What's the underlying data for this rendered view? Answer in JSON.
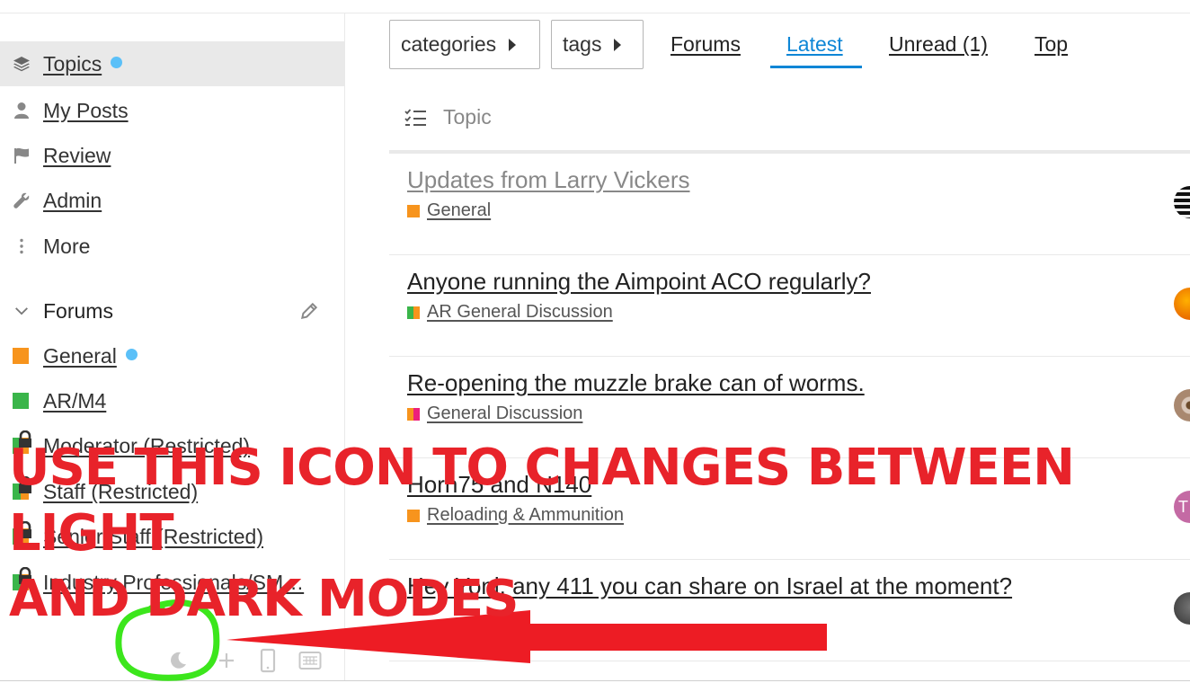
{
  "nav": {
    "categories_label": "categories",
    "tags_label": "tags",
    "forums_label": "Forums",
    "latest_label": "Latest",
    "unread_label": "Unread (1)",
    "top_label": "Top"
  },
  "sidebar": {
    "items": [
      {
        "label": "Topics",
        "icon": "layers-icon"
      },
      {
        "label": "My Posts",
        "icon": "user-icon"
      },
      {
        "label": "Review",
        "icon": "flag-icon"
      },
      {
        "label": "Admin",
        "icon": "wrench-icon"
      },
      {
        "label": "More",
        "icon": "ellipsis-vertical-icon"
      }
    ],
    "forums_header": "Forums",
    "categories": [
      {
        "label": "General",
        "colors": [
          "#f7941d"
        ]
      },
      {
        "label": "AR/M4",
        "colors": [
          "#3ab54a"
        ]
      },
      {
        "label": "Moderator (Restricted)",
        "colors": [
          "#3ab54a",
          "#f7941d"
        ]
      },
      {
        "label": "Staff (Restricted)",
        "colors": [
          "#3ab54a",
          "#f7941d"
        ]
      },
      {
        "label": "Senior Staff (Restricted)",
        "colors": [
          "#3ab54a",
          "#f7941d"
        ]
      },
      {
        "label": "Industry Professionals/SM…",
        "colors": [
          "#3ab54a",
          "#f7941d"
        ]
      }
    ],
    "footer_icons": [
      "moon-icon",
      "plus-icon",
      "mobile-icon",
      "keyboard-icon"
    ]
  },
  "list": {
    "column_header": "Topic",
    "topics": [
      {
        "title": "Updates from Larry Vickers",
        "category": "General",
        "colors": [
          "#f7941d"
        ]
      },
      {
        "title": "Anyone running the Aimpoint ACO regularly?",
        "category": "AR General Discussion",
        "colors": [
          "#3ab54a",
          "#f7941d"
        ]
      },
      {
        "title": "Re-opening the muzzle brake can of worms.",
        "category": "General Discussion",
        "colors": [
          "#f7941d",
          "#ed207b"
        ]
      },
      {
        "title": "Horn75 and N140",
        "category": "Reloading & Ammunition",
        "colors": [
          "#f7941d",
          "#f7941d"
        ],
        "avatar_initial": "T"
      },
      {
        "title": "Hey Yoni, any 411 you can share on Israel at the moment?",
        "category": "",
        "colors": []
      }
    ]
  },
  "annotation": {
    "line1": "USE THIS ICON TO CHANGES BETWEEN LIGHT",
    "line2": "AND DARK MODES"
  },
  "colors": {
    "accent": "#0e86d6",
    "annotation_red": "#e8232a",
    "highlight_green": "#3ce61c",
    "unread_dot": "#5bc0f8"
  }
}
